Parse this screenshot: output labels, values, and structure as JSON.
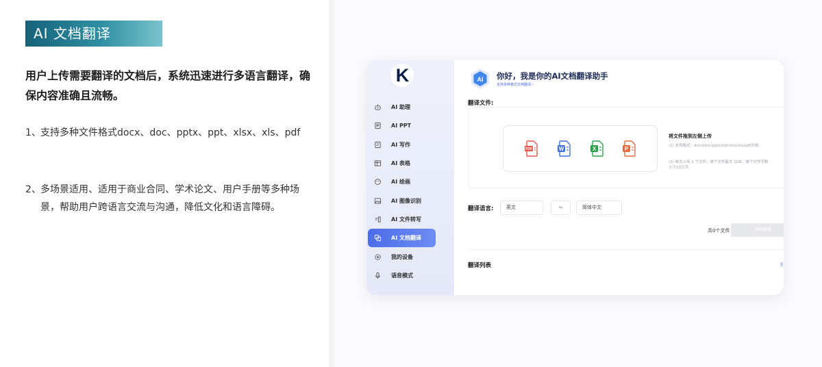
{
  "intro": {
    "title": "AI 文档翻译",
    "description": "用户上传需要翻译的文档后，系统迅速进行多语言翻译，确保内容准确且流畅。",
    "features": [
      {
        "num": "1、",
        "text": "支持多种文件格式docx、doc、pptx、ppt、xlsx、xls、pdf"
      },
      {
        "num": "2、",
        "text": "多场景适用、适用于商业合同、学术论文、用户手册等多种场景，帮助用户跨语言交流与沟通，降低文化和语言障碍。"
      }
    ]
  },
  "app": {
    "logo_text": "K",
    "sidebar": {
      "items": [
        {
          "label": "AI 助理",
          "icon": "robot-icon"
        },
        {
          "label": "AI PPT",
          "icon": "ppt-doc-icon"
        },
        {
          "label": "AI 写作",
          "icon": "write-icon"
        },
        {
          "label": "AI 表格",
          "icon": "table-icon"
        },
        {
          "label": "AI 绘画",
          "icon": "paint-icon"
        },
        {
          "label": "AI 图像识别",
          "icon": "image-scan-icon"
        },
        {
          "label": "AI 文件转写",
          "icon": "transcribe-icon"
        },
        {
          "label": "AI 文档翻译",
          "icon": "translate-icon",
          "active": true
        },
        {
          "label": "我的设备",
          "icon": "device-icon"
        },
        {
          "label": "语音模式",
          "icon": "microphone-icon"
        }
      ]
    },
    "header": {
      "title": "你好，我是你的AI文档翻译助手",
      "subtitle": "支持多种格式文档翻译~"
    },
    "upload": {
      "section_label": "翻译文件:",
      "file_types": [
        "PDF",
        "W",
        "X",
        "P"
      ],
      "title": "将文件拖到左侧上传",
      "note1": "(1) 支持格式：docx/doc/pptx/ppt/xlsx/xls/pdf文档;",
      "note2": "(2) 单次上传 1 个文件，单个文件最大 1GB，单个文件字数小于10万字。"
    },
    "language": {
      "label": "翻译语言:",
      "source": "英文",
      "swap": "⇋",
      "target": "简体中文"
    },
    "action": {
      "count": "共0个文件",
      "start_button": "开始翻译"
    },
    "list": {
      "label": "翻译列表"
    },
    "colors": {
      "accent": "#4c6dea",
      "sidebar_bg": "#eef1fb",
      "title_banner": "#1e6f86",
      "pdf": "#e4574d",
      "word": "#3f6fe0",
      "excel": "#2aa24b",
      "ppt": "#e86a3a"
    }
  }
}
